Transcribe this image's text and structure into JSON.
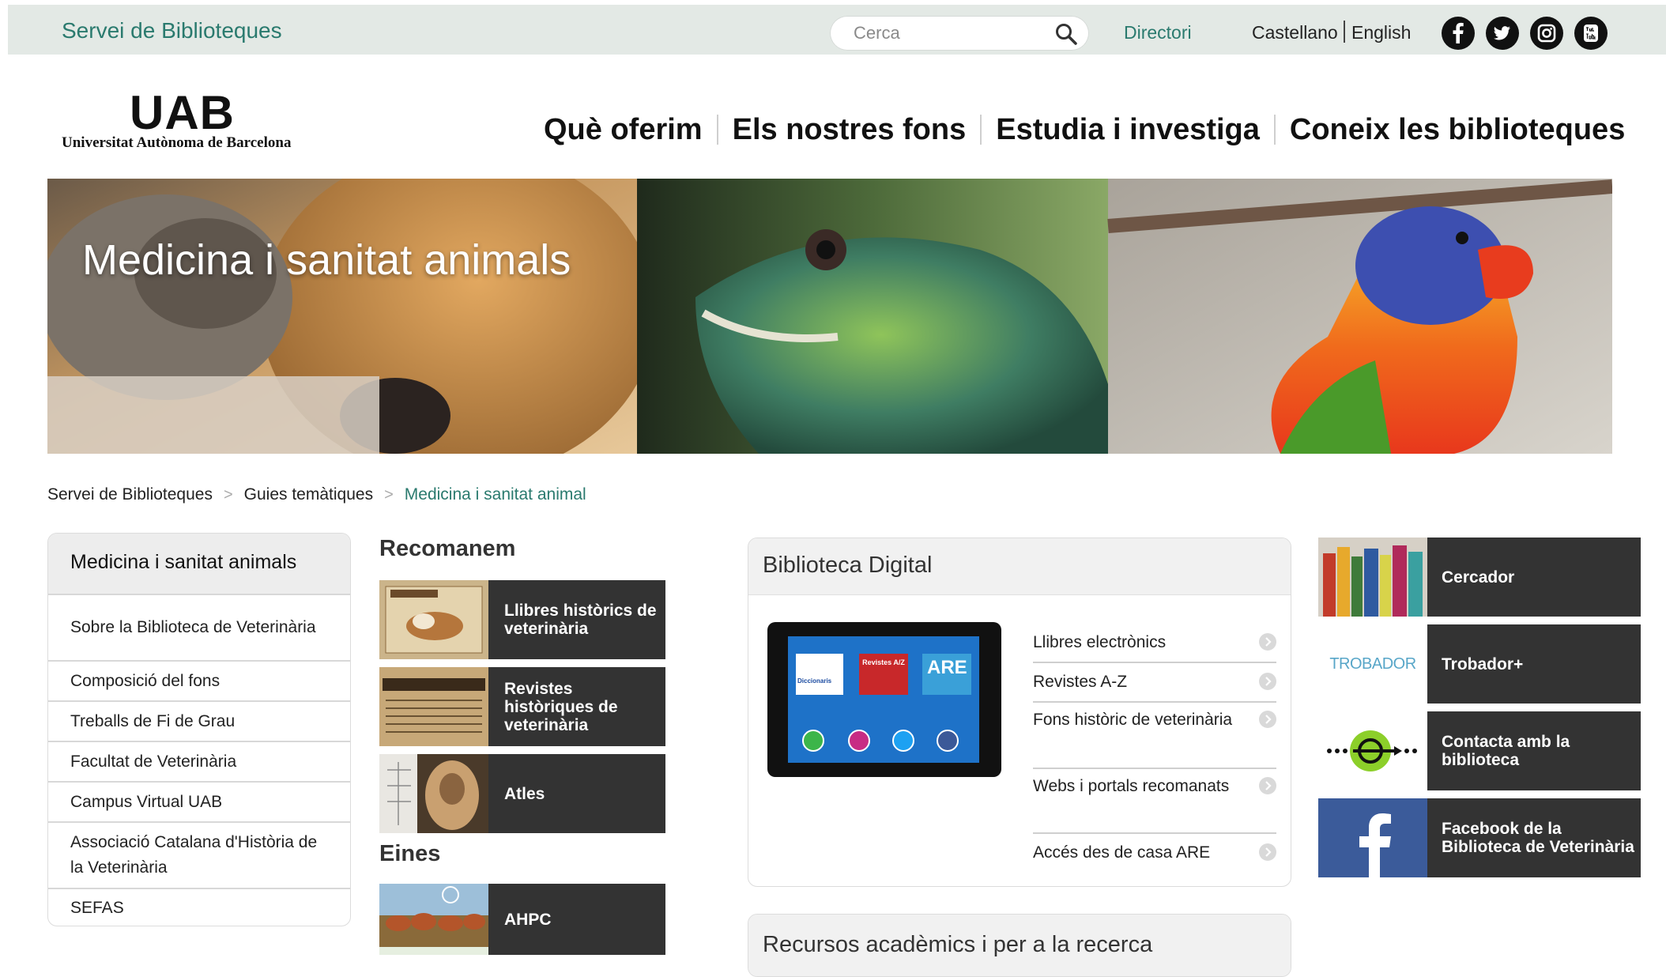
{
  "topbar": {
    "site_title": "Servei de Biblioteques",
    "search_placeholder": "Cerca",
    "directori": "Directori",
    "lang_es": "Castellano",
    "lang_en": "English",
    "social": [
      "facebook-icon",
      "twitter-icon",
      "instagram-icon",
      "youtube-icon"
    ]
  },
  "logo": {
    "mark": "UAB",
    "text": "Universitat Autònoma de Barcelona"
  },
  "nav": [
    {
      "label": "Què oferim"
    },
    {
      "label": "Els nostres fons"
    },
    {
      "label": "Estudia i investiga"
    },
    {
      "label": "Coneix les biblioteques"
    }
  ],
  "banner": {
    "title": "Medicina i sanitat animals"
  },
  "breadcrumb": {
    "items": [
      "Servei de Biblioteques",
      "Guies temàtiques"
    ],
    "separator": ">",
    "current": "Medicina i sanitat animal"
  },
  "sidebar": {
    "title": "Medicina i sanitat animals",
    "items": [
      {
        "label": "Sobre la Biblioteca de Veterinària"
      },
      {
        "label": "Composició del fons"
      },
      {
        "label": "Treballs de Fi de Grau"
      },
      {
        "label": "Facultat de Veterinària"
      },
      {
        "label": "Campus Virtual UAB"
      },
      {
        "label": "Associació Catalana d'Història de la Veterinària"
      },
      {
        "label": "SEFAS"
      }
    ]
  },
  "recomanem": {
    "title": "Recomanem",
    "tiles": [
      {
        "label": "Llibres històrics de veterinària"
      },
      {
        "label": "Revistes històriques de veterinària"
      },
      {
        "label": "Atles"
      }
    ]
  },
  "eines": {
    "title": "Eines",
    "tiles": [
      {
        "label": "AHPC"
      }
    ]
  },
  "biblioteca_digital": {
    "title": "Biblioteca Digital",
    "tablet": {
      "app1": "Diccionaris",
      "app2": "Revistes A/Z",
      "app3": "ARE"
    },
    "links": [
      {
        "label": "Llibres electrònics"
      },
      {
        "label": "Revistes A-Z"
      },
      {
        "label": "Fons històric de veterinària"
      },
      {
        "label": "Webs i portals recomanats"
      },
      {
        "label": "Accés des de casa ARE"
      }
    ]
  },
  "recursos": {
    "title": "Recursos acadèmics i per a la recerca"
  },
  "right_tiles": [
    {
      "label": "Cercador"
    },
    {
      "label": "Trobador+",
      "logo_text": "TROBADOR"
    },
    {
      "label": "Contacta amb la biblioteca"
    },
    {
      "label": "Facebook de la Biblioteca de Veterinària"
    }
  ],
  "colors": {
    "accent": "#2a7a6e",
    "tile_bg": "#333333",
    "topbar_bg": "#e3e9e5"
  }
}
